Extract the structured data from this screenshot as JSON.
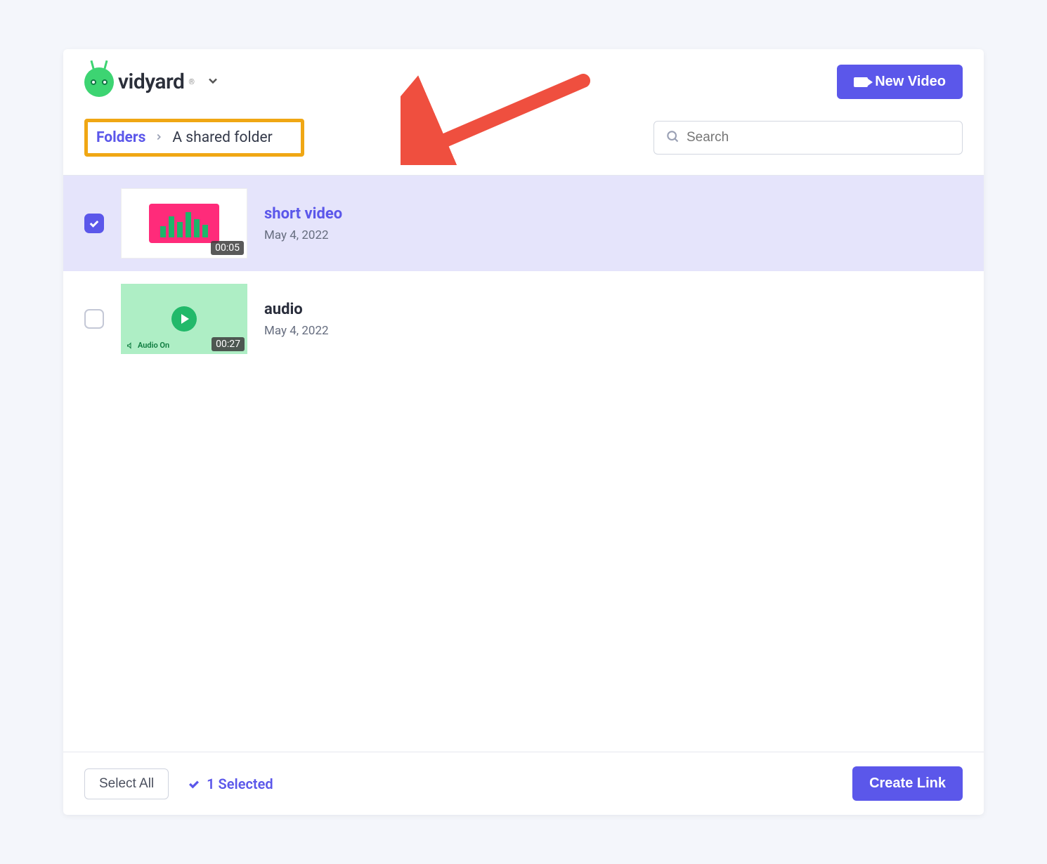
{
  "brand": {
    "name": "vidyard"
  },
  "header": {
    "new_video_label": "New Video"
  },
  "breadcrumb": {
    "root": "Folders",
    "current": "A shared folder"
  },
  "search": {
    "placeholder": "Search"
  },
  "items": [
    {
      "title": "short video",
      "date": "May 4, 2022",
      "duration": "00:05",
      "selected": true
    },
    {
      "title": "audio",
      "date": "May 4, 2022",
      "duration": "00:27",
      "selected": false,
      "audio_caption": "Audio On"
    }
  ],
  "footer": {
    "select_all_label": "Select All",
    "selected_label": "1 Selected",
    "create_link_label": "Create Link"
  }
}
